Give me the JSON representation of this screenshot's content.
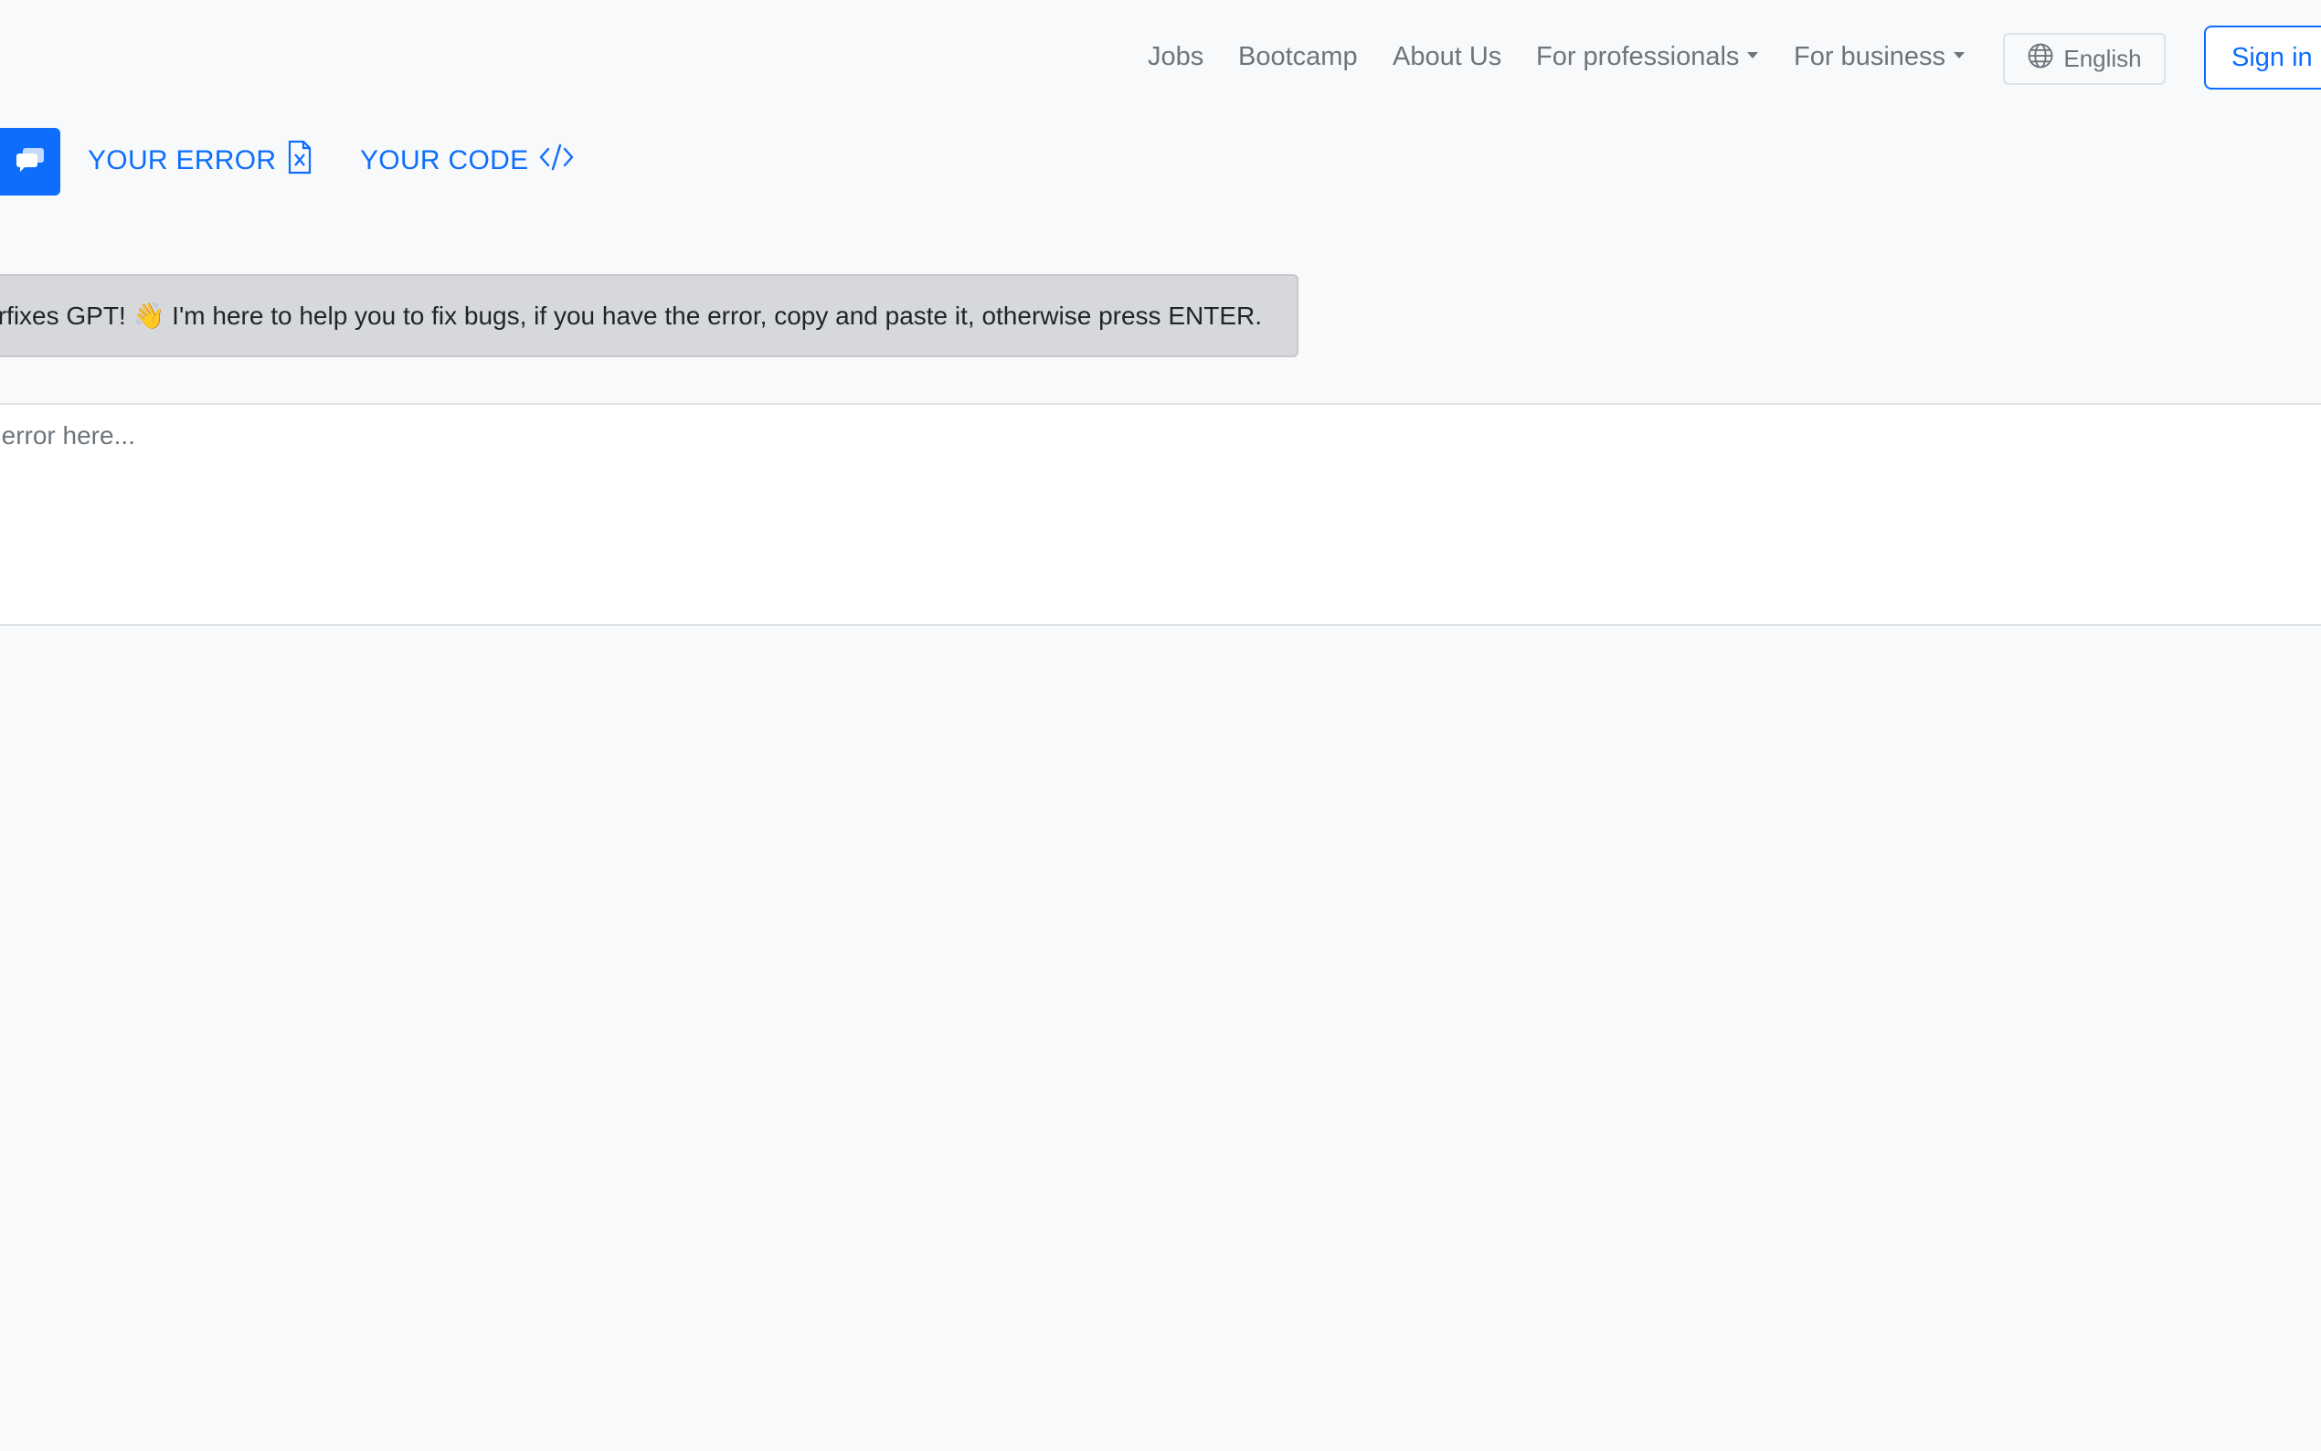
{
  "nav": {
    "links": [
      "Jobs",
      "Bootcamp",
      "About Us"
    ],
    "dropdowns": [
      "For professionals",
      "For business"
    ],
    "language": "English",
    "sign_in": "Sign in"
  },
  "tabs": {
    "error_label": "YOUR ERROR",
    "code_label": "YOUR CODE"
  },
  "chat": {
    "bot_message": "Errorfixes GPT! 👋 I'm here to help you to fix bugs, if you have the error, copy and paste it, otherwise press ENTER.",
    "input_placeholder": "Paste your error here..."
  },
  "colors": {
    "accent": "#0d6efd",
    "background": "#f8f9fa",
    "bot_bubble": "#d6d8db"
  }
}
